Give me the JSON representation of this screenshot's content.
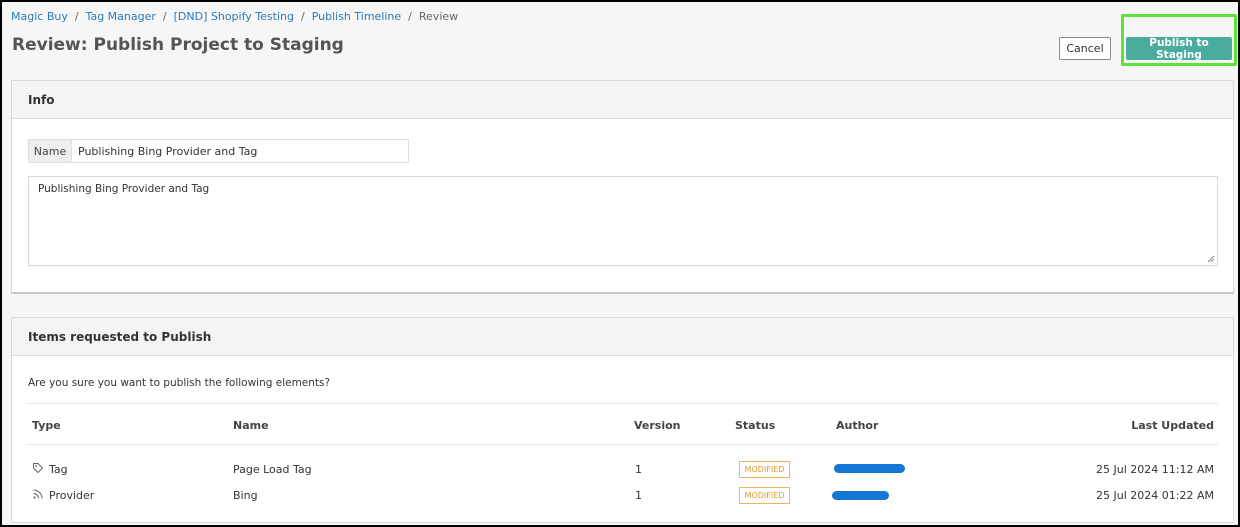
{
  "breadcrumb": {
    "items": [
      "Magic Buy",
      "Tag Manager",
      "[DND] Shopify Testing",
      "Publish Timeline"
    ],
    "current": "Review",
    "separator": "/"
  },
  "page_title": "Review: Publish Project to Staging",
  "actions": {
    "cancel_label": "Cancel",
    "publish_label": "Publish to Staging",
    "publish_color": "#4aac9c",
    "highlight_color": "#5de23a"
  },
  "info": {
    "header": "Info",
    "name_label": "Name",
    "name_value": "Publishing Bing Provider and Tag",
    "description_value": "Publishing Bing Provider and Tag"
  },
  "items": {
    "header": "Items requested to Publish",
    "prompt": "Are you sure you want to publish the following elements?",
    "columns": {
      "type": "Type",
      "name": "Name",
      "version": "Version",
      "status": "Status",
      "author": "Author",
      "last_updated": "Last Updated"
    },
    "rows": [
      {
        "type": "Tag",
        "icon": "tag-icon",
        "name": "Page Load Tag",
        "version": "1",
        "status": "MODIFIED",
        "last_updated": "25 Jul 2024 11:12 AM"
      },
      {
        "type": "Provider",
        "icon": "rss-icon",
        "name": "Bing",
        "version": "1",
        "status": "MODIFIED",
        "last_updated": "25 Jul 2024 01:22 AM"
      }
    ]
  },
  "colors": {
    "link": "#2a7ab8",
    "status_badge": "#e09a2c",
    "redaction": "#1377d4"
  }
}
